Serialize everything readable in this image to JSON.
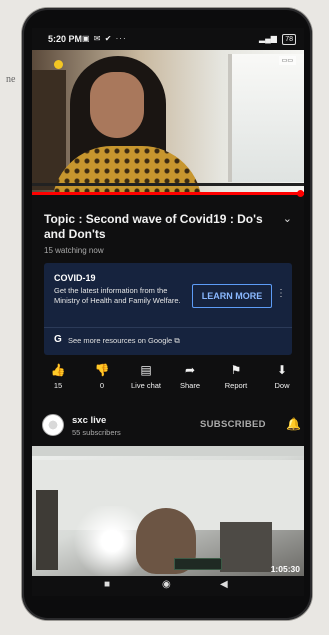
{
  "status_bar": {
    "time": "5:20 PM",
    "left_icons": "▣ ✉ ✔ ···",
    "battery": "78"
  },
  "video": {
    "progress_fraction": 1.0,
    "title": "Topic : Second wave of Covid19 : Do's and Don'ts",
    "viewers": "15 watching now"
  },
  "info_card": {
    "heading": "COVID-19",
    "text": "Get the latest information from the Ministry of Health and Family Welfare.",
    "button_label": "LEARN MORE",
    "google_glyph": "G",
    "more_link": "See more resources on Google"
  },
  "actions": [
    {
      "icon": "👍",
      "icon_name": "like-icon",
      "label": "15"
    },
    {
      "icon": "👎",
      "icon_name": "dislike-icon",
      "label": "0"
    },
    {
      "icon": "▤",
      "icon_name": "live-chat-icon",
      "label": "Live chat"
    },
    {
      "icon": "➦",
      "icon_name": "share-icon",
      "label": "Share"
    },
    {
      "icon": "⚑",
      "icon_name": "report-flag-icon",
      "label": "Report"
    },
    {
      "icon": "⬇",
      "icon_name": "download-icon",
      "label": "Dow"
    }
  ],
  "channel": {
    "name": "sxc live",
    "subscribers": "55 subscribers",
    "subscribe_status": "SUBSCRIBED"
  },
  "video2": {
    "timestamp": "1:05:30"
  },
  "nav": {
    "recents": "■",
    "home": "◉",
    "back": "◀"
  },
  "background_note": "ne",
  "colors": {
    "accent_red": "#ff0000",
    "card_background": "#16233e",
    "button_blue": "#8ab8ff"
  }
}
